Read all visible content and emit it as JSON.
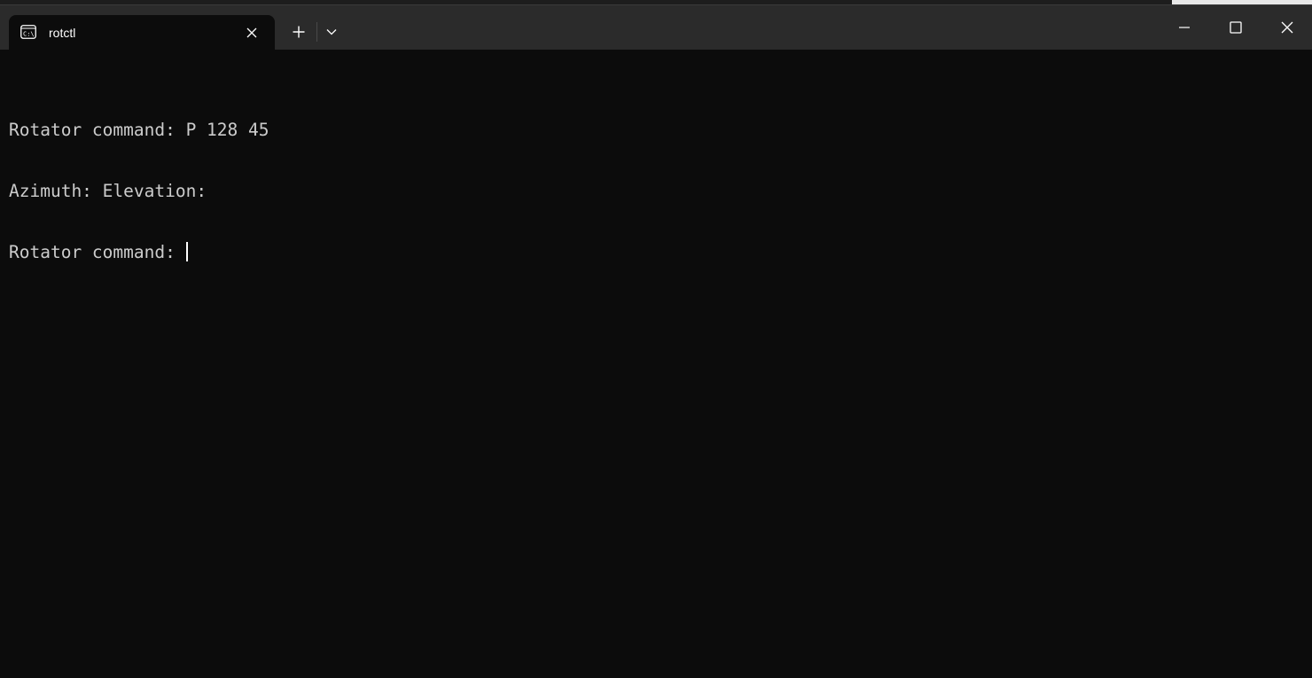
{
  "tab": {
    "title": "rotctl",
    "icon": "cmd-prompt-icon"
  },
  "titlebar": {
    "new_tab_icon": "plus-icon",
    "dropdown_icon": "chevron-down-icon",
    "minimize_icon": "minimize-icon",
    "maximize_icon": "maximize-icon",
    "close_icon": "close-icon"
  },
  "terminal": {
    "lines": [
      "Rotator command: P 128 45",
      "Azimuth: Elevation:",
      "Rotator command: "
    ]
  },
  "colors": {
    "terminal_background": "#0c0c0c",
    "terminal_text": "#cccccc",
    "titlebar_background": "#2b2b2b"
  }
}
